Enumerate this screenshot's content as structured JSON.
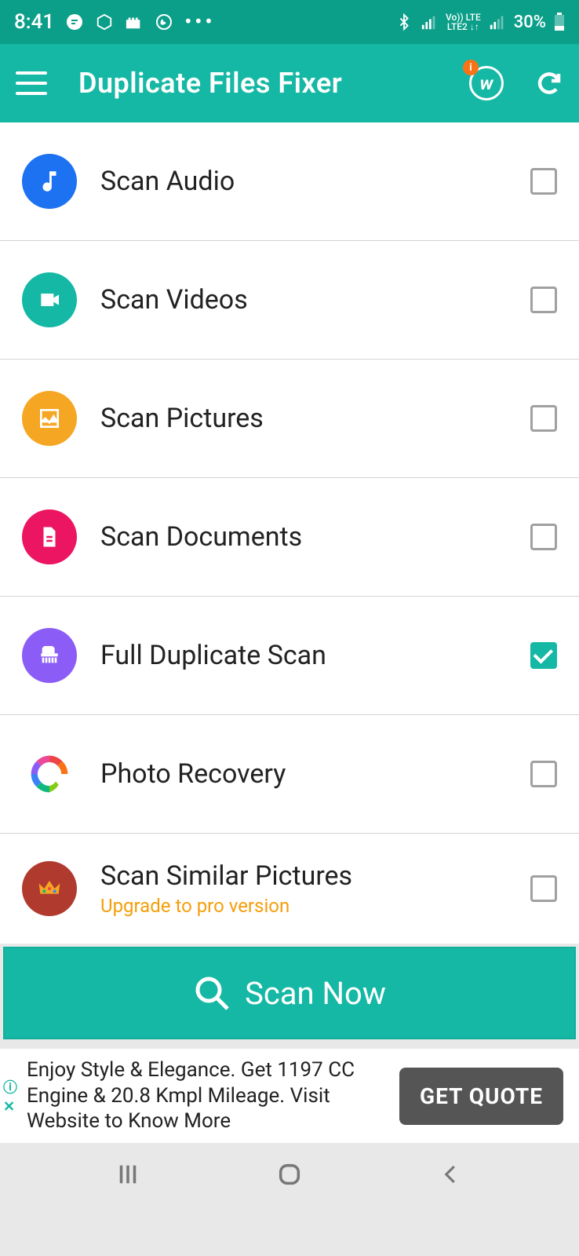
{
  "status": {
    "time": "8:41",
    "battery": "30%",
    "network_label": "Vo)) LTE\nLTE2 ↓↑"
  },
  "appbar": {
    "title": "Duplicate Files Fixer"
  },
  "items": [
    {
      "label": "Scan Audio",
      "checked": false
    },
    {
      "label": "Scan Videos",
      "checked": false
    },
    {
      "label": "Scan Pictures",
      "checked": false
    },
    {
      "label": "Scan Documents",
      "checked": false
    },
    {
      "label": "Full Duplicate Scan",
      "checked": true
    },
    {
      "label": "Photo Recovery",
      "checked": false
    },
    {
      "label": "Scan Similar Pictures",
      "sub": "Upgrade to pro version",
      "checked": false
    }
  ],
  "scan_button": "Scan Now",
  "ad": {
    "text": "Enjoy Style & Elegance. Get 1197 CC Engine & 20.8 Kmpl Mileage. Visit Website to Know More",
    "cta": "GET QUOTE"
  }
}
